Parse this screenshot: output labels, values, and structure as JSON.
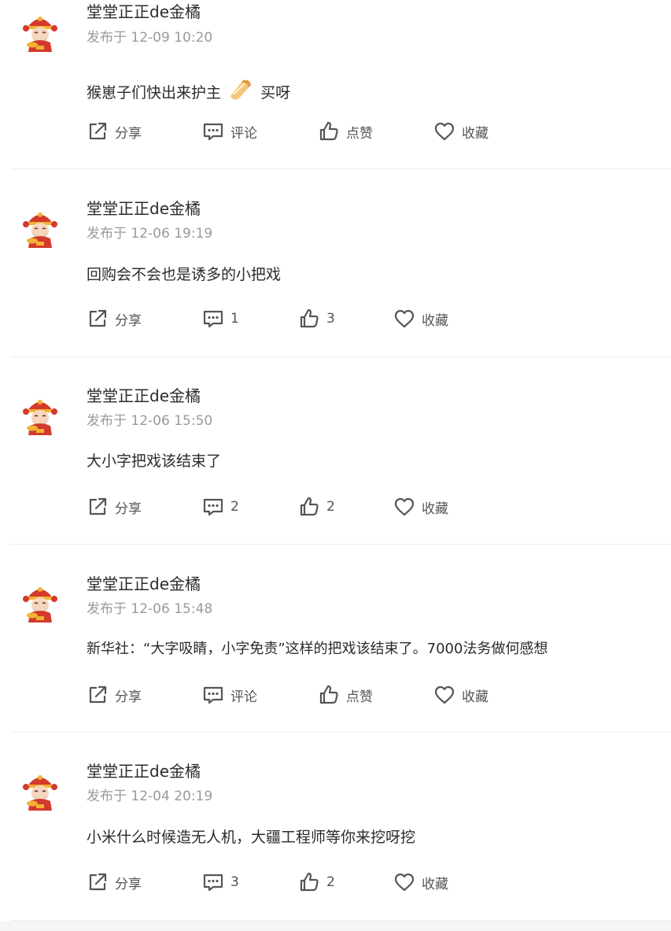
{
  "posts": [
    {
      "author": "堂堂正正de金橘",
      "time": "发布于 12-09 10:20",
      "content": "猴崽子们快出来护主",
      "content_suffix": "买呀",
      "share_label": "分享",
      "comment_label": "评论",
      "like_label": "点赞",
      "collect_label": "收藏"
    },
    {
      "author": "堂堂正正de金橘",
      "time": "发布于 12-06 19:19",
      "content": "回购会不会也是诱多的小把戏",
      "share_label": "分享",
      "comment_label": "1",
      "like_label": "3",
      "collect_label": "收藏"
    },
    {
      "author": "堂堂正正de金橘",
      "time": "发布于 12-06 15:50",
      "content": "大小字把戏该结束了",
      "share_label": "分享",
      "comment_label": "2",
      "like_label": "2",
      "collect_label": "收藏"
    },
    {
      "author": "堂堂正正de金橘",
      "time": "发布于 12-06 15:48",
      "content": "新华社：“大字吸睛，小字免责”这样的把戏该结束了。7000法务做何感想",
      "share_label": "分享",
      "comment_label": "评论",
      "like_label": "点赞",
      "collect_label": "收藏"
    },
    {
      "author": "堂堂正正de金橘",
      "time": "发布于 12-04 20:19",
      "content": "小米什么时候造无人机，大疆工程师等你来挖呀挖",
      "share_label": "分享",
      "comment_label": "3",
      "like_label": "2",
      "collect_label": "收藏"
    }
  ],
  "icons": {
    "share": "share-icon",
    "comment": "comment-icon",
    "like": "thumbs-up-icon",
    "collect": "heart-icon",
    "avatar": "caishen-avatar",
    "sticker": "bread-sticker-emoji"
  },
  "colors": {
    "text": "#2b2b2b",
    "meta": "#9a9a9a",
    "action": "#555555",
    "divider": "#eeeeee",
    "avatar_red": "#d33a2c",
    "avatar_gold": "#f2b233"
  }
}
